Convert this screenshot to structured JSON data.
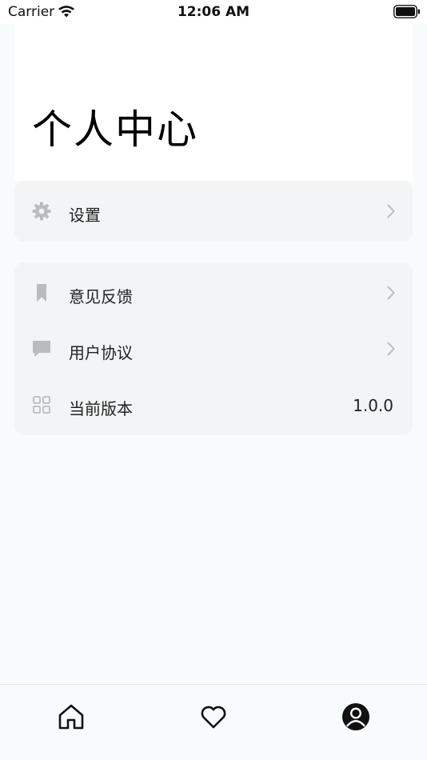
{
  "status": {
    "carrier": "Carrier",
    "time": "12:06 AM"
  },
  "page": {
    "title": "个人中心"
  },
  "menu": {
    "settings": {
      "label": "设置",
      "icon": "gear-icon"
    },
    "feedback": {
      "label": "意见反馈",
      "icon": "bookmark-icon"
    },
    "agreement": {
      "label": "用户协议",
      "icon": "chat-bubble-icon"
    },
    "version": {
      "label": "当前版本",
      "value": "1.0.0",
      "icon": "grid-icon"
    }
  },
  "tabs": [
    {
      "name": "home",
      "icon": "home-icon"
    },
    {
      "name": "favorites",
      "icon": "heart-icon"
    },
    {
      "name": "profile",
      "icon": "user-icon",
      "active": true
    }
  ],
  "colors": {
    "background": "#f7fbfc",
    "card": "#f2f4f5",
    "icon": "#b8bcbf"
  }
}
